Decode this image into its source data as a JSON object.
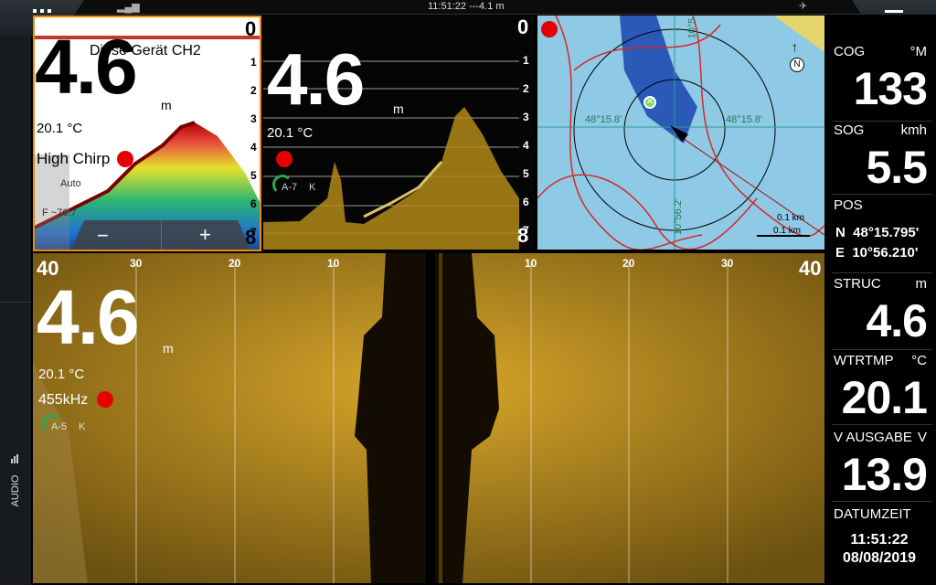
{
  "status_bar": {
    "text": "11:51:22 ---4.1 m"
  },
  "left_rail": {
    "audio_label": "AUDIO"
  },
  "panel1": {
    "depth": "4.6",
    "unit": "m",
    "temp": "20.1 °C",
    "mode": "High Chirp",
    "title": "Diese Gerät CH2",
    "scale_top": "0",
    "scale": [
      "1",
      "2",
      "3",
      "4",
      "5",
      "6",
      "7"
    ],
    "scale_bottom": "8",
    "auto_label": "Auto",
    "freq_label": "F ~76.7",
    "minus": "−",
    "plus": "+"
  },
  "panel2": {
    "depth": "4.6",
    "unit": "m",
    "temp": "20.1 °C",
    "gain": "A-7",
    "gain_k": "K",
    "scale_top": "0",
    "scale": [
      "1",
      "2",
      "3",
      "4",
      "5",
      "6",
      "7"
    ],
    "scale_bottom": "8"
  },
  "map": {
    "lat_label_left": "48°15.8'",
    "lat_label_right": "48°15.8'",
    "lon_label_bottom": "10°56.2'",
    "lon_label_top": "10°5",
    "range1": "0.1 km",
    "range2": "0.1 km",
    "north": "N"
  },
  "sidescan": {
    "depth": "4.6",
    "unit": "m",
    "temp": "20.1 °C",
    "freq": "455kHz",
    "gain": "A-5",
    "gain_k": "K",
    "edge_left": "40",
    "edge_right": "40",
    "ticks_left": [
      "30",
      "20",
      "10"
    ],
    "ticks_right": [
      "10",
      "20",
      "30"
    ]
  },
  "data_panel": {
    "cog": {
      "label": "COG",
      "unit": "°M",
      "value": "133"
    },
    "sog": {
      "label": "SOG",
      "unit": "kmh",
      "value": "5.5"
    },
    "pos": {
      "label": "POS",
      "lat": "N  48°15.795'",
      "lon": "E  10°56.210'"
    },
    "struc": {
      "label": "STRUC",
      "unit": "m",
      "value": "4.6"
    },
    "wtrtmp": {
      "label": "WTRTMP",
      "unit": "°C",
      "value": "20.1"
    },
    "vausgabe": {
      "label": "V AUSGABE",
      "unit": "V",
      "value": "13.9"
    },
    "datum": {
      "label": "DATUMZEIT",
      "time": "11:51:22",
      "date": "08/08/2019"
    }
  },
  "colors": {
    "sidescan": "#b8860b",
    "map_water": "#8ecae6",
    "track": "#d62828",
    "accent_orange": "#f08a00",
    "record": "#e60000"
  }
}
